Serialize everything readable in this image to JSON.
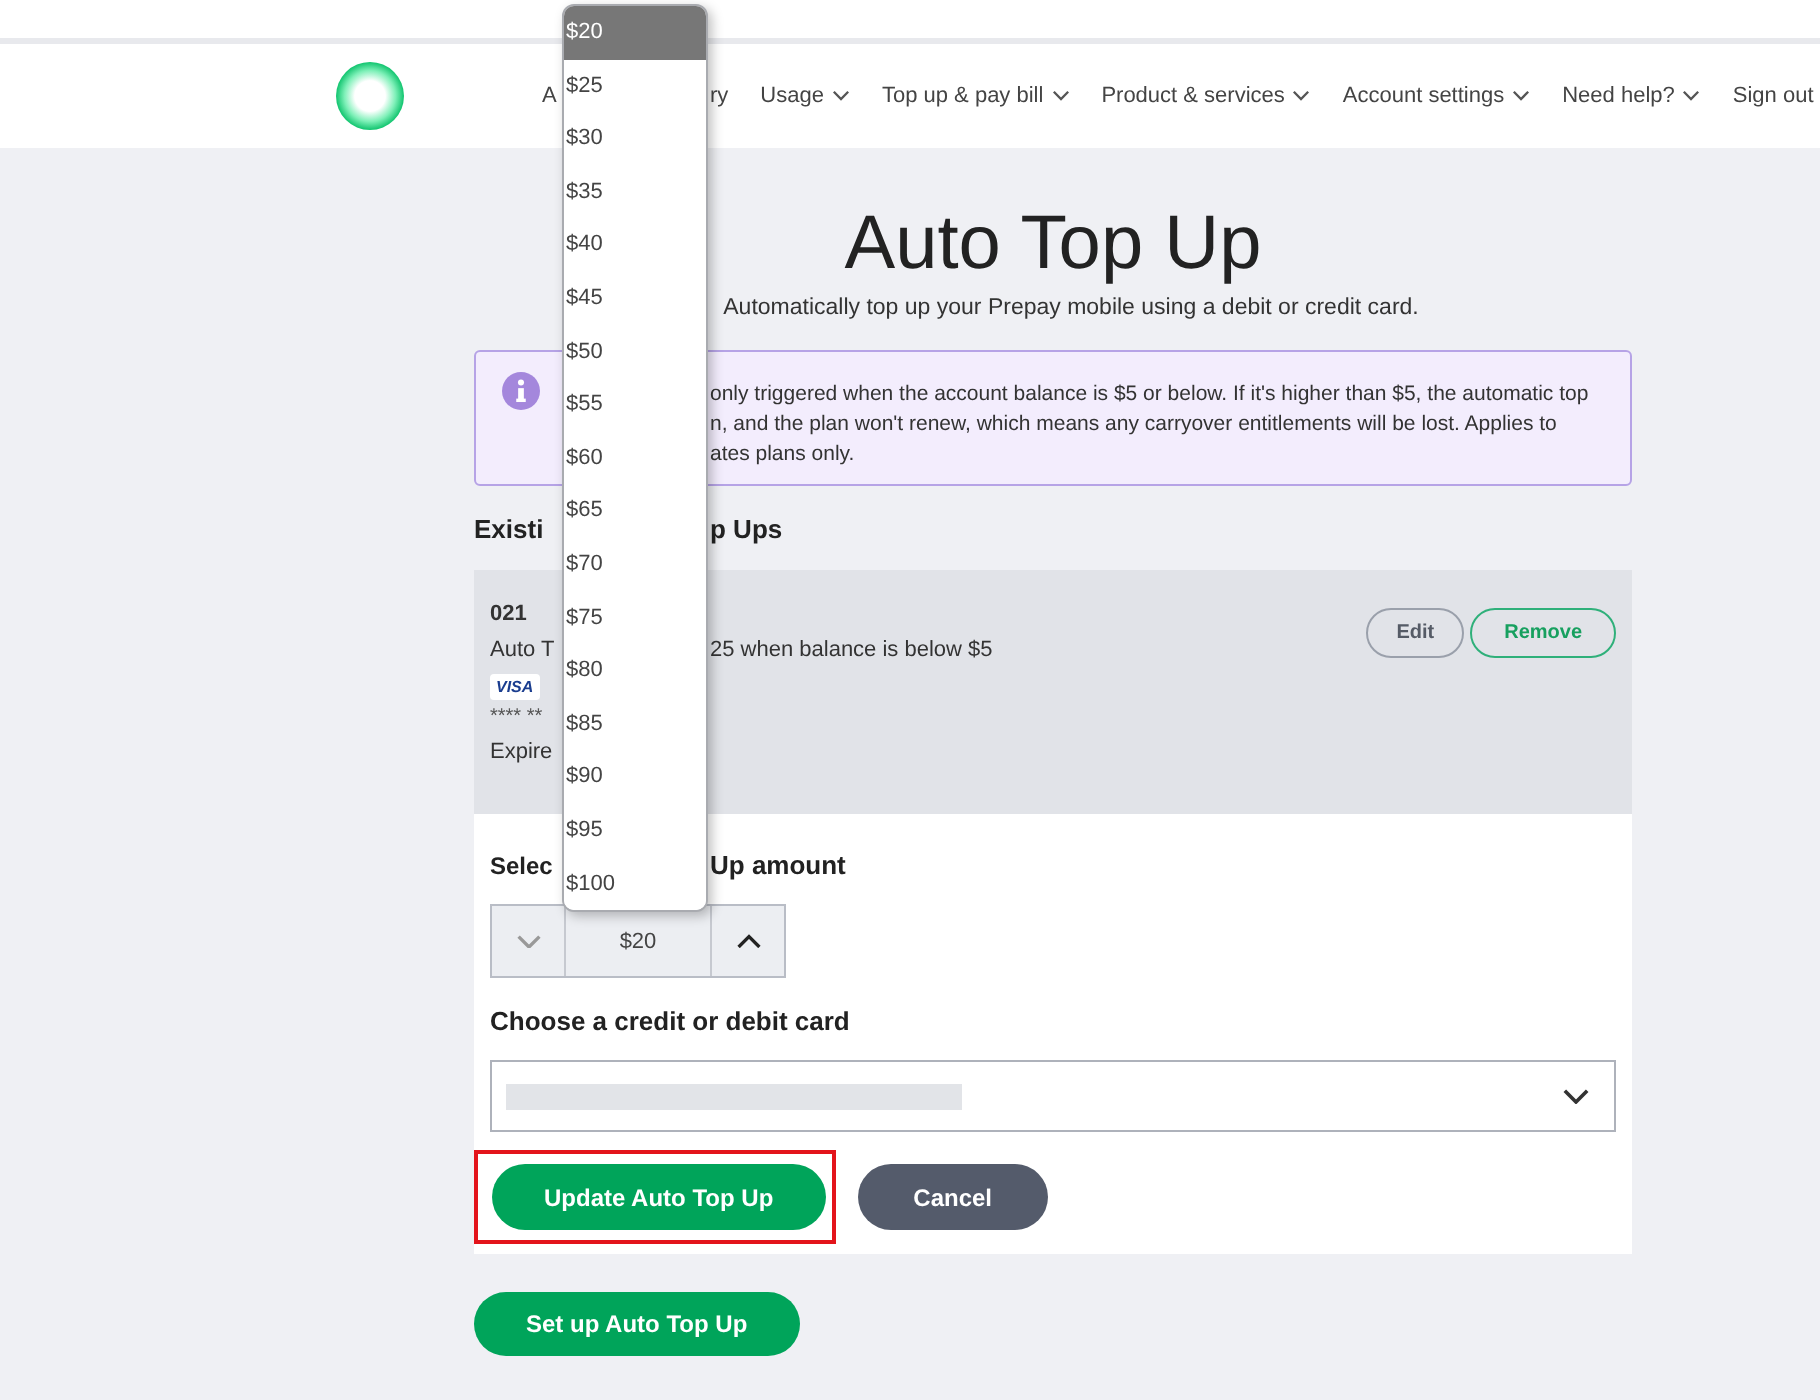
{
  "nav": {
    "items": [
      {
        "parts": [
          "A",
          "ry"
        ]
      },
      {
        "label": "Usage",
        "has_menu": true
      },
      {
        "label": "Top up & pay bill",
        "has_menu": true
      },
      {
        "label": "Product & services",
        "has_menu": true
      },
      {
        "label": "Account settings",
        "has_menu": true
      },
      {
        "label": "Need help?",
        "has_menu": true
      },
      {
        "label": "Sign out",
        "has_menu": false
      }
    ]
  },
  "title": "Auto Top Up",
  "subtitle": "Automatically top up your Prepay mobile using a debit or credit card.",
  "notice": {
    "lines": [
      "only triggered when the account balance is $5 or below. If it's higher than $5, the automatic top",
      "n, and the plan won't renew, which means any carryover entitlements will be lost. Applies to",
      "ates plans only."
    ]
  },
  "existing_heading": [
    "Existi",
    "p Ups"
  ],
  "existing": {
    "number": "021",
    "description": [
      "Auto T",
      "25 when balance is below $5"
    ],
    "card_brand": "VISA",
    "card_number": "**** **",
    "expiry": "Expire",
    "edit": "Edit",
    "remove": "Remove"
  },
  "amount_label": [
    "Selec",
    "Up amount"
  ],
  "amount_value": "$20",
  "card_label": "Choose a credit or debit card",
  "buttons": [
    {
      "label": "Update Auto Top Up",
      "kind": "primary",
      "highlighted": true
    },
    {
      "label": "Cancel",
      "kind": "secondary",
      "highlighted": false
    }
  ],
  "setup_button": "Set up Auto Top Up",
  "amount_options": [
    {
      "label": "$20",
      "selected": true
    },
    {
      "label": "$25",
      "selected": false
    },
    {
      "label": "$30",
      "selected": false
    },
    {
      "label": "$35",
      "selected": false
    },
    {
      "label": "$40",
      "selected": false
    },
    {
      "label": "$45",
      "selected": false
    },
    {
      "label": "$50",
      "selected": false
    },
    {
      "label": "$55",
      "selected": false
    },
    {
      "label": "$60",
      "selected": false
    },
    {
      "label": "$65",
      "selected": false
    },
    {
      "label": "$70",
      "selected": false
    },
    {
      "label": "$75",
      "selected": false
    },
    {
      "label": "$80",
      "selected": false
    },
    {
      "label": "$85",
      "selected": false
    },
    {
      "label": "$90",
      "selected": false
    },
    {
      "label": "$95",
      "selected": false
    },
    {
      "label": "$100",
      "selected": false
    }
  ]
}
